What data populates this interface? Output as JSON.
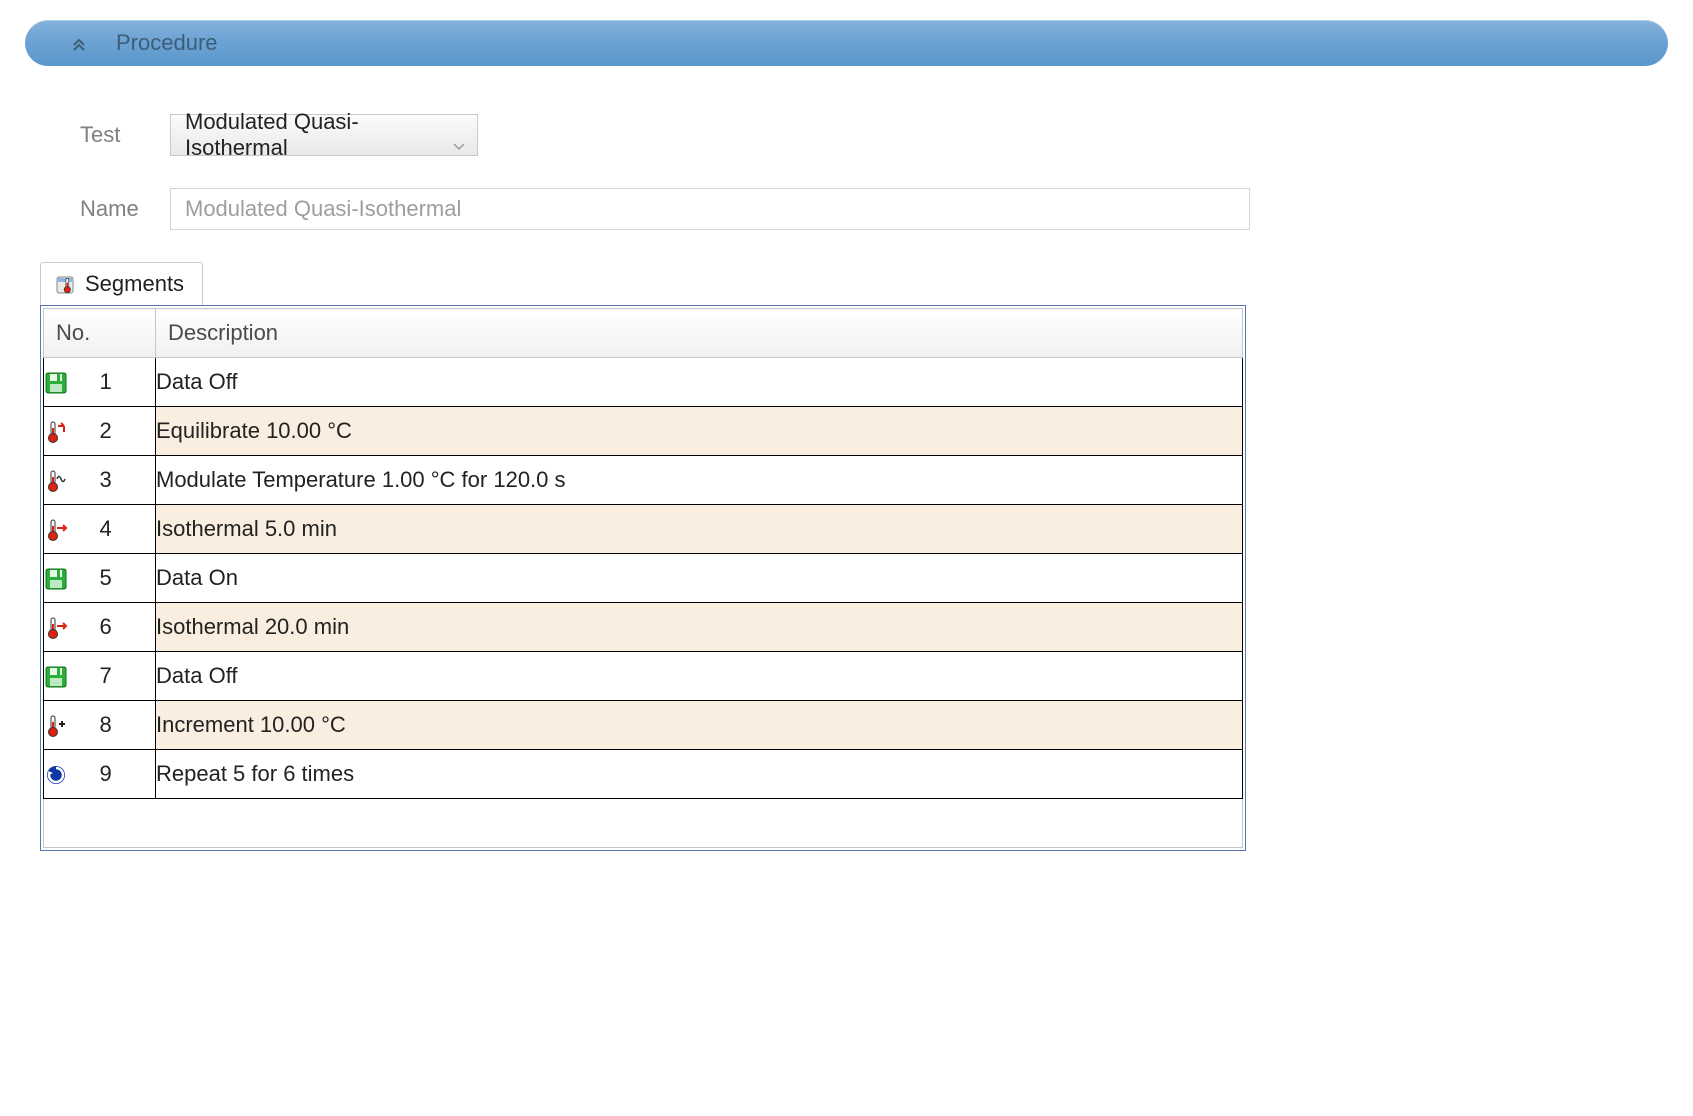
{
  "header": {
    "title": "Procedure"
  },
  "form": {
    "test_label": "Test",
    "test_value": "Modulated Quasi-Isothermal",
    "name_label": "Name",
    "name_value": "Modulated Quasi-Isothermal"
  },
  "tabs": {
    "segments_label": "Segments"
  },
  "table": {
    "col_no": "No.",
    "col_desc": "Description",
    "rows": [
      {
        "num": "1",
        "icon": "disk",
        "alt": false,
        "desc": "Data Off"
      },
      {
        "num": "2",
        "icon": "therm-turn",
        "alt": true,
        "desc": "Equilibrate 10.00 °C"
      },
      {
        "num": "3",
        "icon": "therm-wave",
        "alt": false,
        "desc": "Modulate Temperature 1.00 °C for 120.0 s"
      },
      {
        "num": "4",
        "icon": "therm-arrow",
        "alt": true,
        "desc": "Isothermal 5.0 min"
      },
      {
        "num": "5",
        "icon": "disk",
        "alt": false,
        "desc": "Data On"
      },
      {
        "num": "6",
        "icon": "therm-arrow",
        "alt": true,
        "desc": "Isothermal 20.0 min"
      },
      {
        "num": "7",
        "icon": "disk",
        "alt": false,
        "desc": "Data Off"
      },
      {
        "num": "8",
        "icon": "therm-plus",
        "alt": true,
        "desc": "Increment 10.00 °C"
      },
      {
        "num": "9",
        "icon": "repeat",
        "alt": false,
        "desc": "Repeat 5  for 6 times"
      }
    ]
  }
}
